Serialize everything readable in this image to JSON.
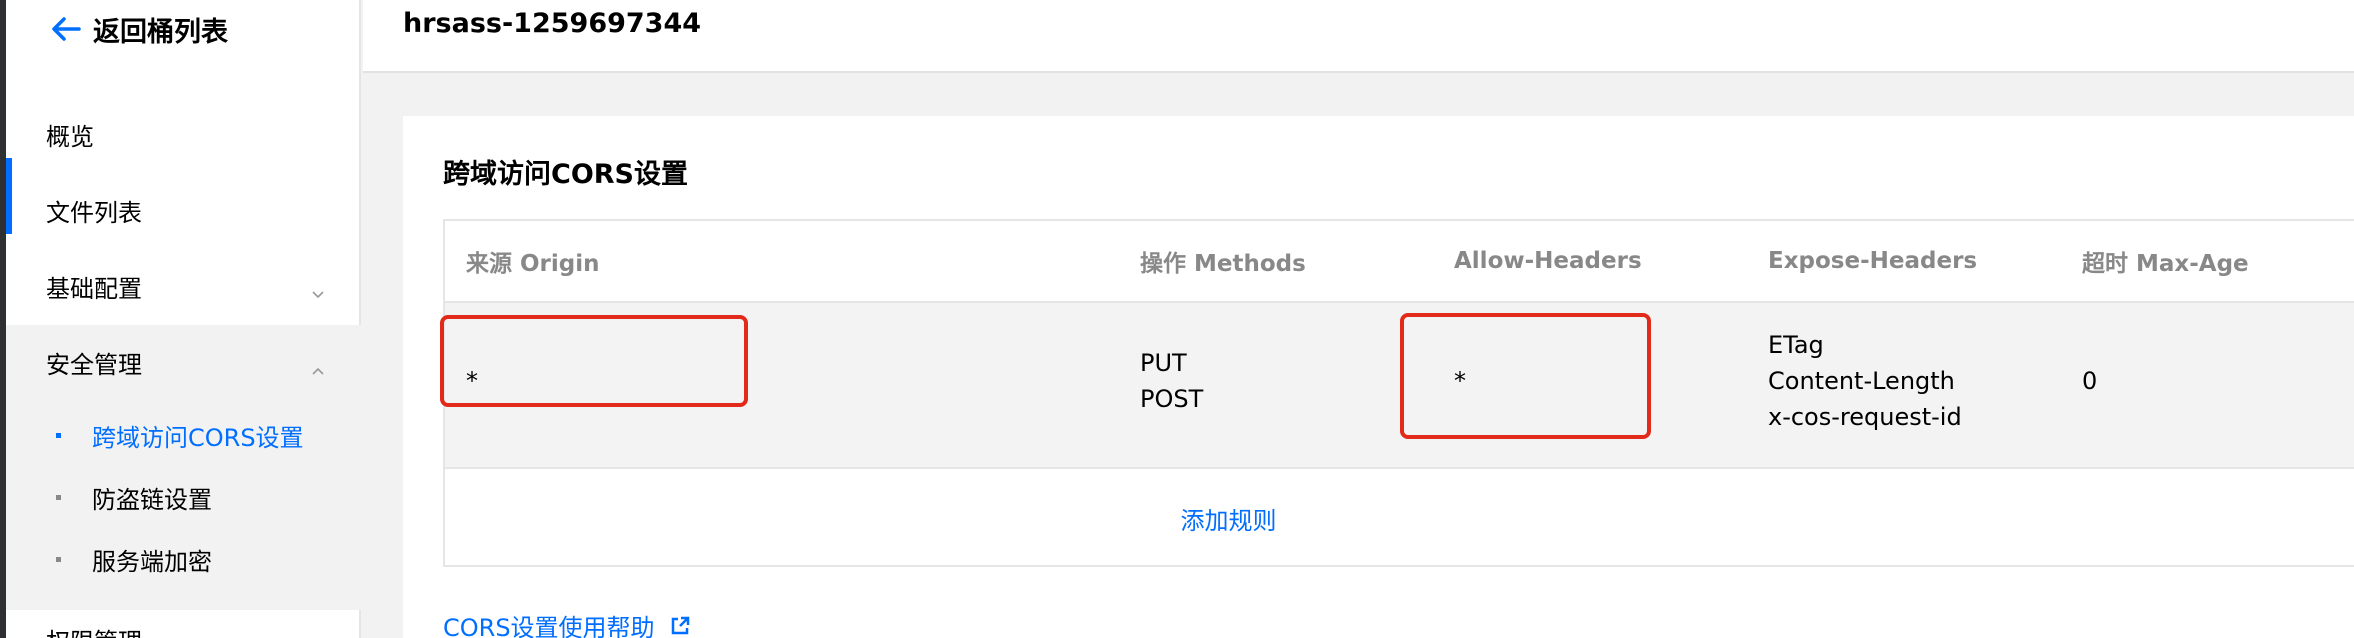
{
  "sidebar": {
    "back_label": "返回桶列表",
    "items": [
      {
        "label": "概览"
      },
      {
        "label": "文件列表"
      },
      {
        "label": "基础配置"
      },
      {
        "label": "安全管理"
      }
    ],
    "security_sub_items": [
      {
        "label": "跨域访问CORS设置",
        "active": true
      },
      {
        "label": "防盗链设置"
      },
      {
        "label": "服务端加密"
      }
    ],
    "cutoff_item": "权限管理"
  },
  "header": {
    "bucket_name": "hrsass-1259697344"
  },
  "main": {
    "section_title": "跨域访问CORS设置",
    "table": {
      "columns": [
        "来源 Origin",
        "操作 Methods",
        "Allow-Headers",
        "Expose-Headers",
        "超时 Max-Age"
      ],
      "rows": [
        {
          "origin": "*",
          "methods": [
            "PUT",
            "POST"
          ],
          "allow_headers": "*",
          "expose_headers": [
            "ETag",
            "Content-Length",
            "x-cos-request-id"
          ],
          "max_age": "0"
        }
      ],
      "add_rule_label": "添加规则"
    },
    "help_link": "CORS设置使用帮助"
  },
  "colors": {
    "accent": "#006eff",
    "highlight": "#e22a1b"
  },
  "icons": {
    "back": "arrow-left-icon",
    "expand": "chevron-down-icon",
    "collapse": "chevron-up-icon",
    "external": "external-link-icon"
  }
}
